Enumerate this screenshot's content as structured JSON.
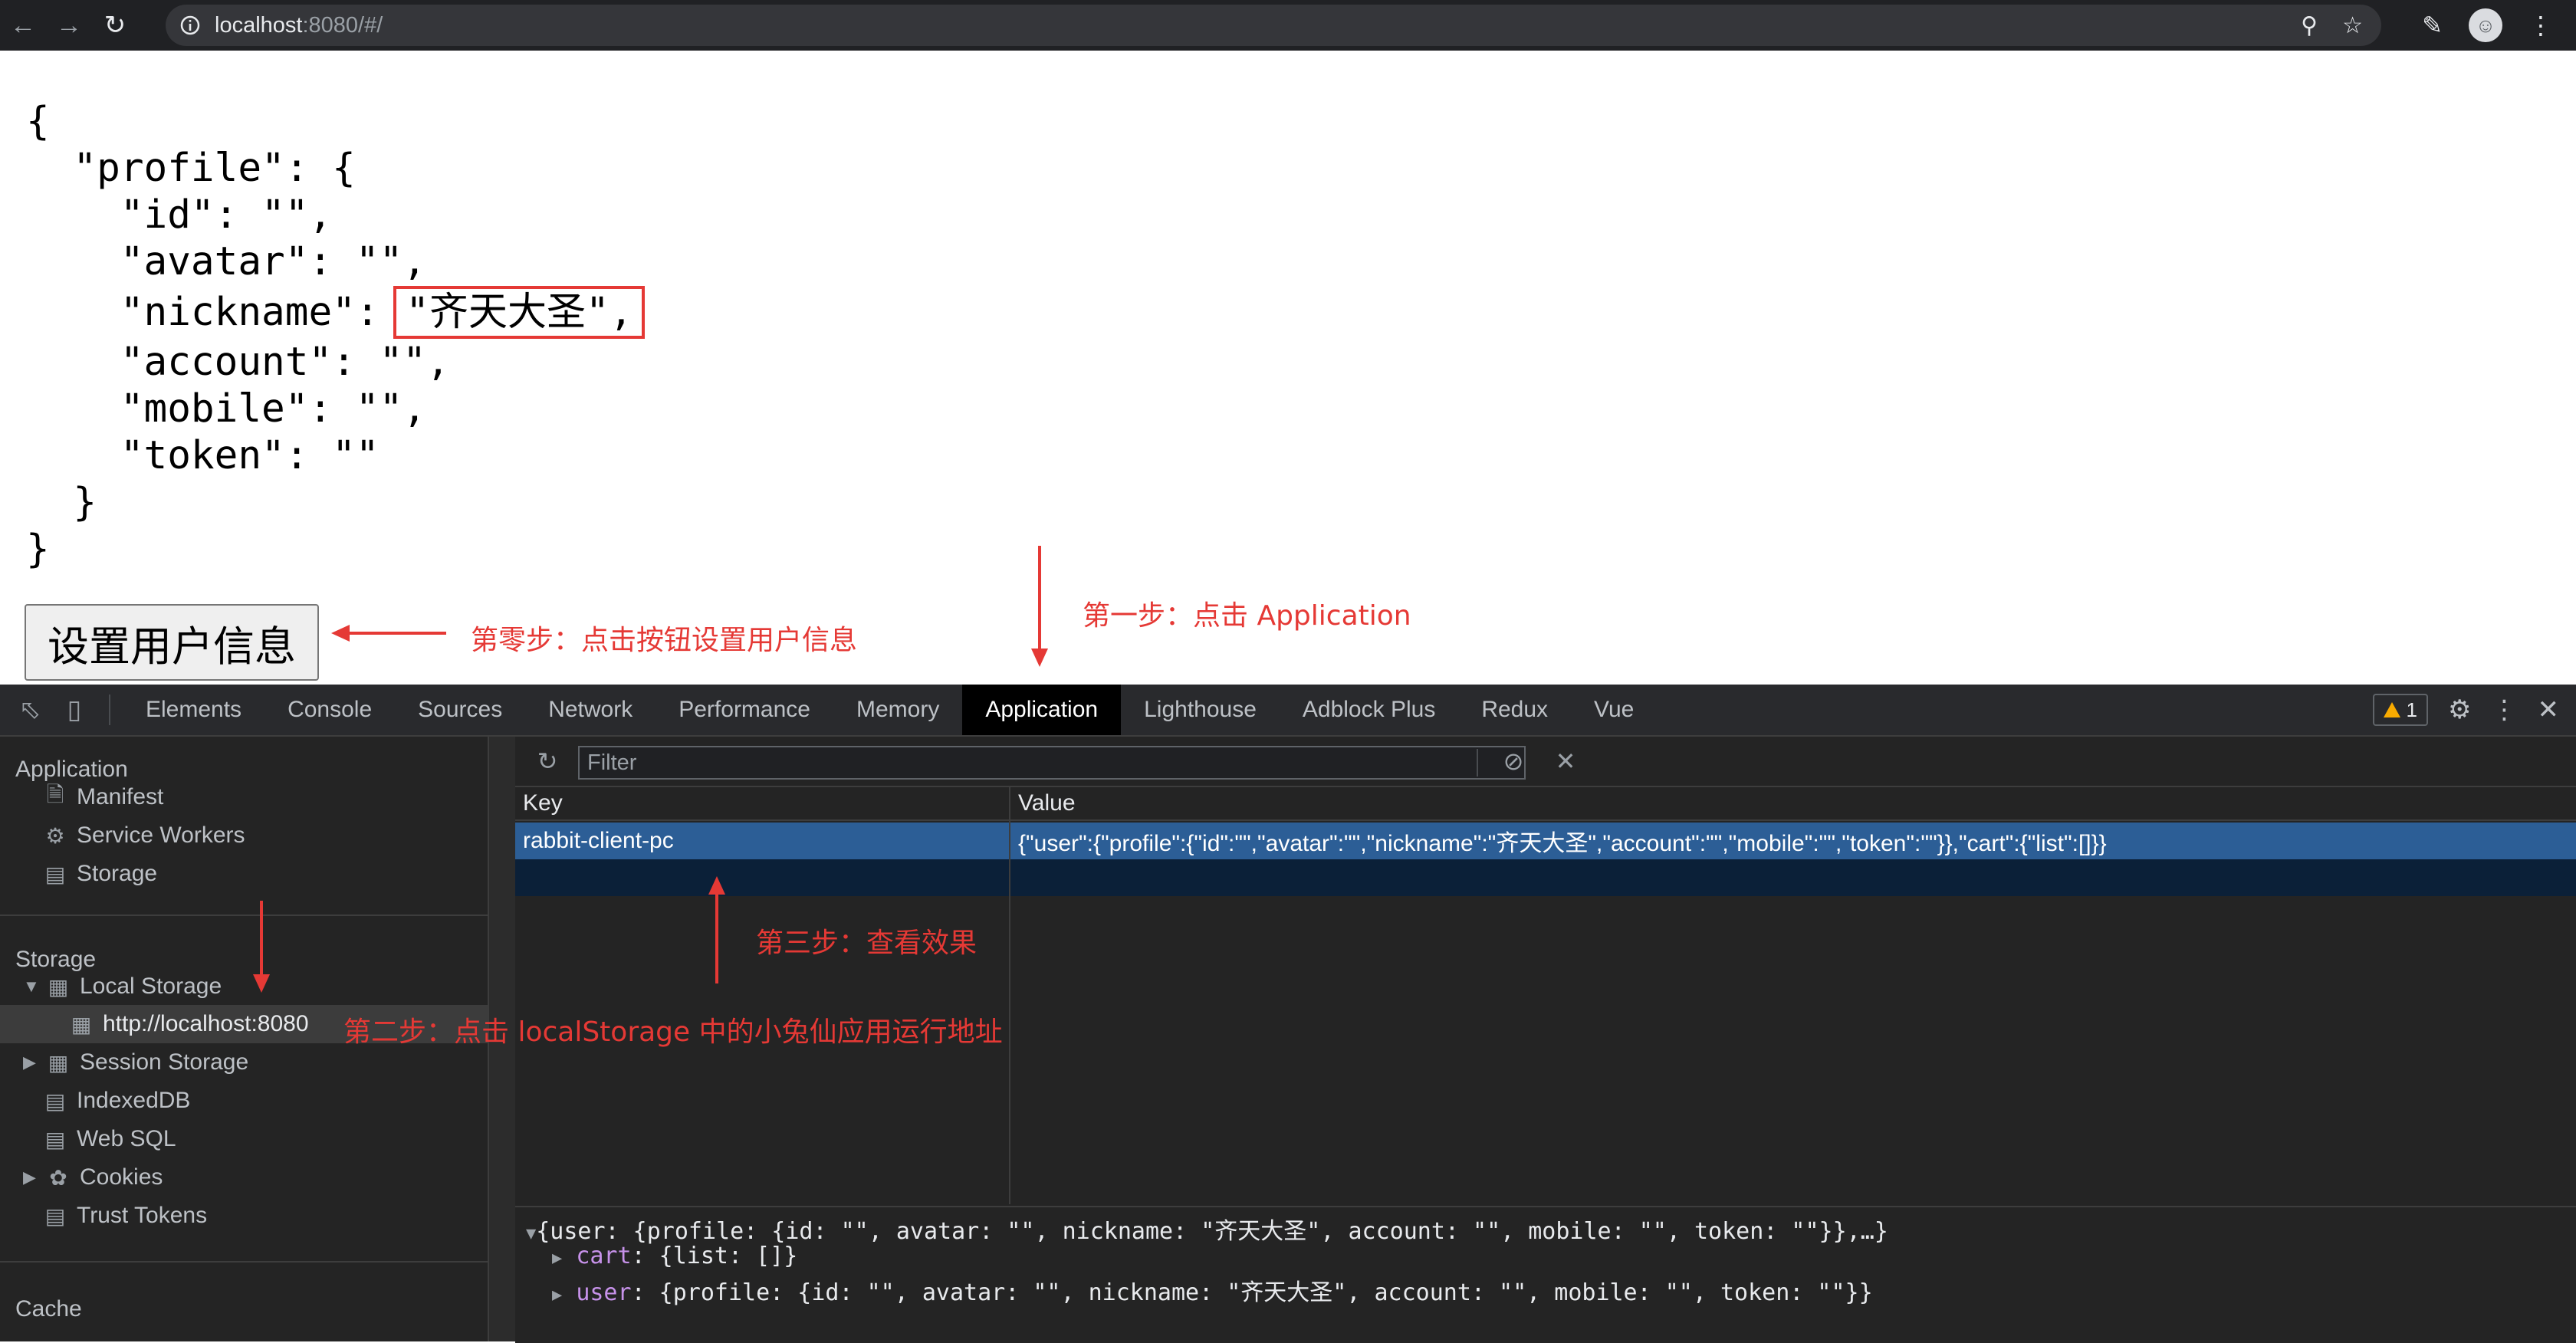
{
  "browser": {
    "url_host": "localhost",
    "url_rest": ":8080/#/",
    "icons": [
      "back-icon",
      "forward-icon",
      "reload-icon",
      "info-icon",
      "zoom-icon",
      "star-icon",
      "extensions-icon",
      "profile-icon"
    ]
  },
  "page": {
    "json_lines": [
      "{",
      "  \"profile\": {",
      "    \"id\": \"\",",
      "    \"avatar\": \"\",",
      "    \"nickname\": ",
      "    \"account\": \"\",",
      "    \"mobile\": \"\",",
      "    \"token\": \"\"",
      "  }",
      "}"
    ],
    "nickname_value": "\"齐天大圣\",",
    "button_label": "设置用户信息"
  },
  "annotations": {
    "step0": "第零步：点击按钮设置用户信息",
    "step1": "第一步：点击 Application",
    "step2": "第二步：点击 localStorage 中的小兔仙应用运行地址",
    "step3": "第三步：查看效果",
    "color": "#e53935"
  },
  "devtools": {
    "tabs": [
      "Elements",
      "Console",
      "Sources",
      "Network",
      "Performance",
      "Memory",
      "Application",
      "Lighthouse",
      "Adblock Plus",
      "Redux",
      "Vue"
    ],
    "active_tab": "Application",
    "warning_count": "1",
    "sidebar": {
      "application_header": "Application",
      "application_items": [
        "Manifest",
        "Service Workers",
        "Storage"
      ],
      "storage_header": "Storage",
      "storage_items": [
        "Local Storage",
        "http://localhost:8080",
        "Session Storage",
        "IndexedDB",
        "Web SQL",
        "Cookies",
        "Trust Tokens"
      ],
      "cache_header": "Cache"
    },
    "filter_placeholder": "Filter",
    "table": {
      "columns": [
        "Key",
        "Value"
      ],
      "rows": [
        {
          "key": "rabbit-client-pc",
          "value": "{\"user\":{\"profile\":{\"id\":\"\",\"avatar\":\"\",\"nickname\":\"齐天大圣\",\"account\":\"\",\"mobile\":\"\",\"token\":\"\"}},\"cart\":{\"list\":[]}}"
        }
      ]
    },
    "preview": {
      "line1": "{user: {profile: {id: \"\", avatar: \"\", nickname: \"齐天大圣\", account: \"\", mobile: \"\", token: \"\"}},…}",
      "line2_key": "cart",
      "line2_val": ": {list: []}",
      "line3_key": "user",
      "line3_val": ": {profile: {id: \"\", avatar: \"\", nickname: \"齐天大圣\", account: \"\", mobile: \"\", token: \"\"}}"
    },
    "selected_row_color": "#2c5e96"
  }
}
